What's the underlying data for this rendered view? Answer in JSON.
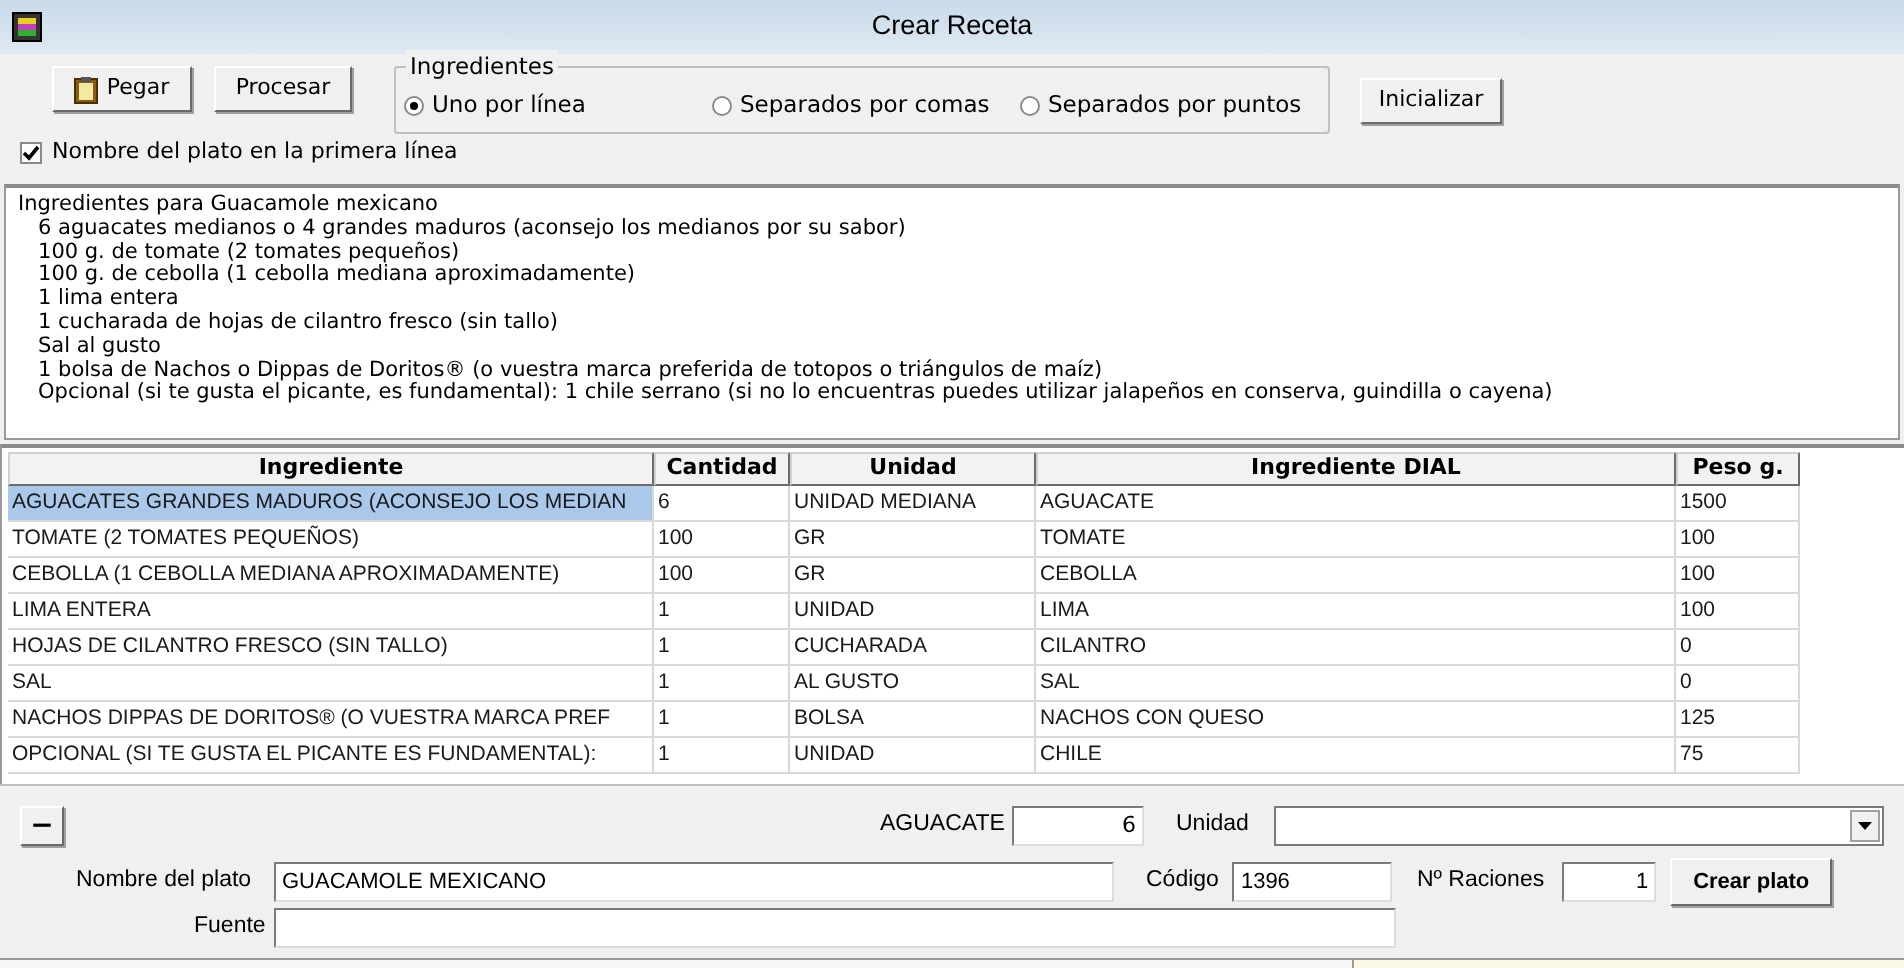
{
  "window": {
    "title": "Crear Receta"
  },
  "toolbar": {
    "paste_button": "Pegar",
    "process_button": "Procesar",
    "reset_button": "Inicializar"
  },
  "ingredients_group": {
    "title": "Ingredientes",
    "options": [
      {
        "label": "Uno por línea",
        "selected": true
      },
      {
        "label": "Separados por comas",
        "selected": false
      },
      {
        "label": "Separados por puntos",
        "selected": false
      }
    ]
  },
  "dish_name_first_line": {
    "label": "Nombre del plato en la primera línea",
    "checked": true
  },
  "recipe_text": {
    "lines": [
      "Ingredientes para Guacamole mexicano",
      "   6 aguacates medianos o 4 grandes maduros (aconsejo los medianos por su sabor)",
      "   100 g. de tomate (2 tomates pequeños)",
      "   100 g. de cebolla (1 cebolla mediana aproximadamente)",
      "   1 lima entera",
      "   1 cucharada de hojas de cilantro fresco (sin tallo)",
      "   Sal al gusto",
      "   1 bolsa de Nachos o Dippas de Doritos® (o vuestra marca preferida de totopos o triángulos de maíz)",
      "   Opcional (si te gusta el picante, es fundamental): 1 chile serrano (si no lo encuentras puedes utilizar jalapeños en conserva, guindilla o cayena)"
    ]
  },
  "table": {
    "columns": [
      "Ingrediente",
      "Cantidad",
      "Unidad",
      "Ingrediente DIAL",
      "Peso g."
    ],
    "rows": [
      {
        "cells": [
          "AGUACATES GRANDES MADUROS (ACONSEJO LOS MEDIAN",
          "6",
          "UNIDAD MEDIANA",
          "AGUACATE",
          "1500"
        ],
        "selected": true
      },
      {
        "cells": [
          "TOMATE (2 TOMATES PEQUEÑOS)",
          "100",
          "GR",
          "TOMATE",
          "100"
        ],
        "selected": false
      },
      {
        "cells": [
          "CEBOLLA (1 CEBOLLA MEDIANA APROXIMADAMENTE)",
          "100",
          "GR",
          "CEBOLLA",
          "100"
        ],
        "selected": false
      },
      {
        "cells": [
          "LIMA ENTERA",
          "1",
          "UNIDAD",
          "LIMA",
          "100"
        ],
        "selected": false
      },
      {
        "cells": [
          "HOJAS DE CILANTRO FRESCO (SIN TALLO)",
          "1",
          "CUCHARADA",
          "CILANTRO",
          "0"
        ],
        "selected": false
      },
      {
        "cells": [
          "SAL",
          "1",
          "AL GUSTO",
          "SAL",
          "0"
        ],
        "selected": false
      },
      {
        "cells": [
          "NACHOS DIPPAS DE DORITOS® (O VUESTRA MARCA PREF",
          "1",
          "BOLSA",
          "NACHOS CON QUESO",
          "125"
        ],
        "selected": false
      },
      {
        "cells": [
          "OPCIONAL (SI TE GUSTA EL PICANTE  ES FUNDAMENTAL):",
          "1",
          "UNIDAD",
          "CHILE",
          "75"
        ],
        "selected": false
      }
    ]
  },
  "editor": {
    "remove_button": "−",
    "ingredient_label": "AGUACATE",
    "quantity_value": "6",
    "unit_label": "Unidad",
    "dish_name_label": "Nombre del plato",
    "dish_name_value": "GUACAMOLE MEXICANO",
    "code_label": "Código",
    "code_value": "1396",
    "servings_label": "Nº Raciones",
    "servings_value": "1",
    "create_button": "Crear plato",
    "source_label": "Fuente"
  }
}
